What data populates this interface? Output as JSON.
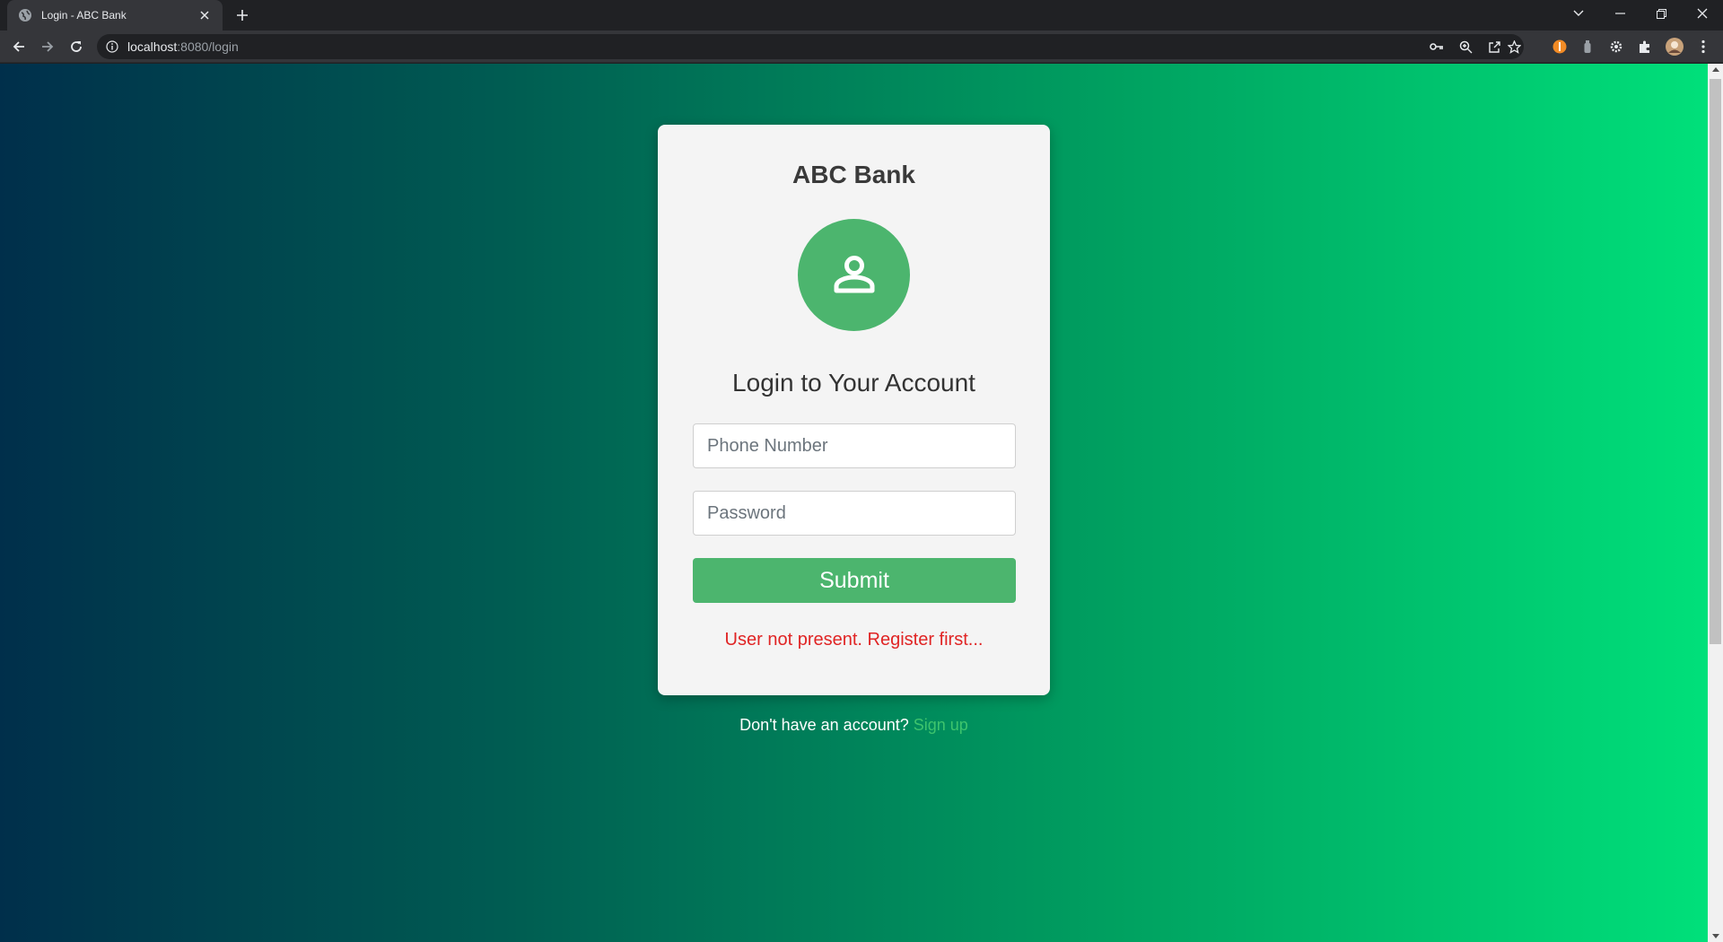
{
  "browser": {
    "tab_title": "Login - ABC Bank",
    "url_host": "localhost",
    "url_path": ":8080/login",
    "icons": [
      "back-icon",
      "forward-icon",
      "reload-icon",
      "info-icon",
      "key-icon",
      "zoom-icon",
      "share-icon",
      "star-icon",
      "extensions-icon",
      "profile-icon",
      "menu-icon"
    ]
  },
  "login": {
    "bank_name": "ABC Bank",
    "heading": "Login to Your Account",
    "phone_placeholder": "Phone Number",
    "password_placeholder": "Password",
    "submit_label": "Submit",
    "error_message": "User not present. Register first...",
    "signup_prompt": "Don't have an account?",
    "signup_link": "Sign up"
  },
  "colors": {
    "accent": "#4cb56e",
    "error": "#e02424",
    "link": "#3ec46d"
  }
}
